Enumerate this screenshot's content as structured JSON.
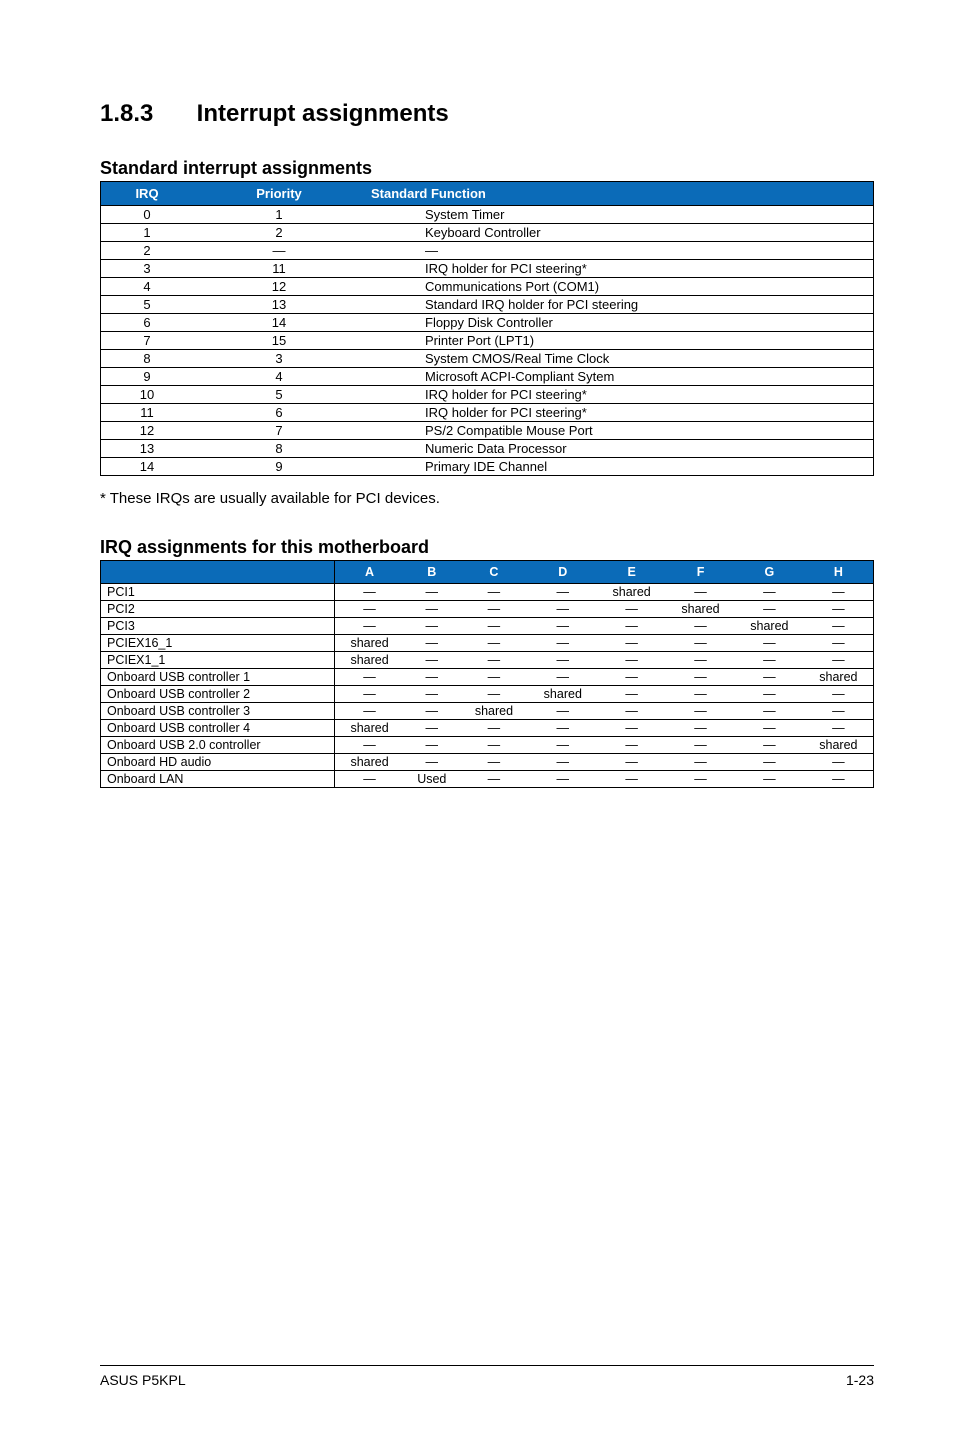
{
  "section": {
    "number": "1.8.3",
    "title": "Interrupt assignments"
  },
  "std_table": {
    "title": "Standard interrupt assignments",
    "headers": [
      "IRQ",
      "Priority",
      "Standard Function"
    ],
    "rows": [
      [
        "0",
        "1",
        "System Timer"
      ],
      [
        "1",
        "2",
        "Keyboard Controller"
      ],
      [
        "2",
        "—",
        "—"
      ],
      [
        "3",
        "11",
        "IRQ holder for PCI steering*"
      ],
      [
        "4",
        "12",
        "Communications Port (COM1)"
      ],
      [
        "5",
        "13",
        "Standard IRQ holder for PCI steering"
      ],
      [
        "6",
        "14",
        "Floppy Disk Controller"
      ],
      [
        "7",
        "15",
        "Printer Port (LPT1)"
      ],
      [
        "8",
        "3",
        "System CMOS/Real Time Clock"
      ],
      [
        "9",
        "4",
        "Microsoft ACPI-Compliant Sytem"
      ],
      [
        "10",
        "5",
        "IRQ holder for PCI steering*"
      ],
      [
        "11",
        "6",
        "IRQ holder for PCI steering*"
      ],
      [
        "12",
        "7",
        "PS/2 Compatible Mouse Port"
      ],
      [
        "13",
        "8",
        "Numeric Data Processor"
      ],
      [
        "14",
        "9",
        "Primary IDE Channel"
      ]
    ]
  },
  "footnote": "* These IRQs are usually available for PCI devices.",
  "irq_table": {
    "title": "IRQ assignments for this motherboard",
    "headers": [
      "",
      "A",
      "B",
      "C",
      "D",
      "E",
      "F",
      "G",
      "H"
    ],
    "rows": [
      [
        "PCI1",
        "—",
        "—",
        "—",
        "—",
        "shared",
        "—",
        "—",
        "—"
      ],
      [
        "PCI2",
        "—",
        "—",
        "—",
        "—",
        "—",
        "shared",
        "—",
        "—"
      ],
      [
        "PCI3",
        "—",
        "—",
        "—",
        "—",
        "—",
        "—",
        "shared",
        "—"
      ],
      [
        "PCIEX16_1",
        "shared",
        "—",
        "—",
        "—",
        "—",
        "—",
        "—",
        "—"
      ],
      [
        "PCIEX1_1",
        "shared",
        "—",
        "—",
        "—",
        "—",
        "—",
        "—",
        "—"
      ],
      [
        "Onboard USB controller 1",
        "—",
        "—",
        "—",
        "—",
        "—",
        "—",
        "—",
        "shared"
      ],
      [
        "Onboard USB controller 2",
        "—",
        "—",
        "—",
        "shared",
        "—",
        "—",
        "—",
        "—"
      ],
      [
        "Onboard USB controller 3",
        "—",
        "—",
        "shared",
        "—",
        "—",
        "—",
        "—",
        "—"
      ],
      [
        "Onboard USB controller 4",
        "shared",
        "—",
        "—",
        "—",
        "—",
        "—",
        "—",
        "—"
      ],
      [
        "Onboard USB 2.0 controller",
        "—",
        "—",
        "—",
        "—",
        "—",
        "—",
        "—",
        "shared"
      ],
      [
        "Onboard HD audio",
        "shared",
        "—",
        "—",
        "—",
        "—",
        "—",
        "—",
        "—"
      ],
      [
        "Onboard LAN",
        "—",
        "Used",
        "—",
        "—",
        "—",
        "—",
        "—",
        "—"
      ]
    ]
  },
  "footer": {
    "left": "ASUS P5KPL",
    "right": "1-23"
  }
}
